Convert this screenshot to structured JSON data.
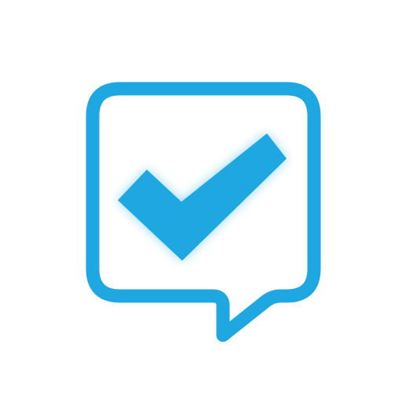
{
  "icon": {
    "name": "speech-bubble-checkmark-icon",
    "accent_color": "#1ea7e1",
    "background_color": "#ffffff",
    "glow_color": "#7fd0f3"
  }
}
